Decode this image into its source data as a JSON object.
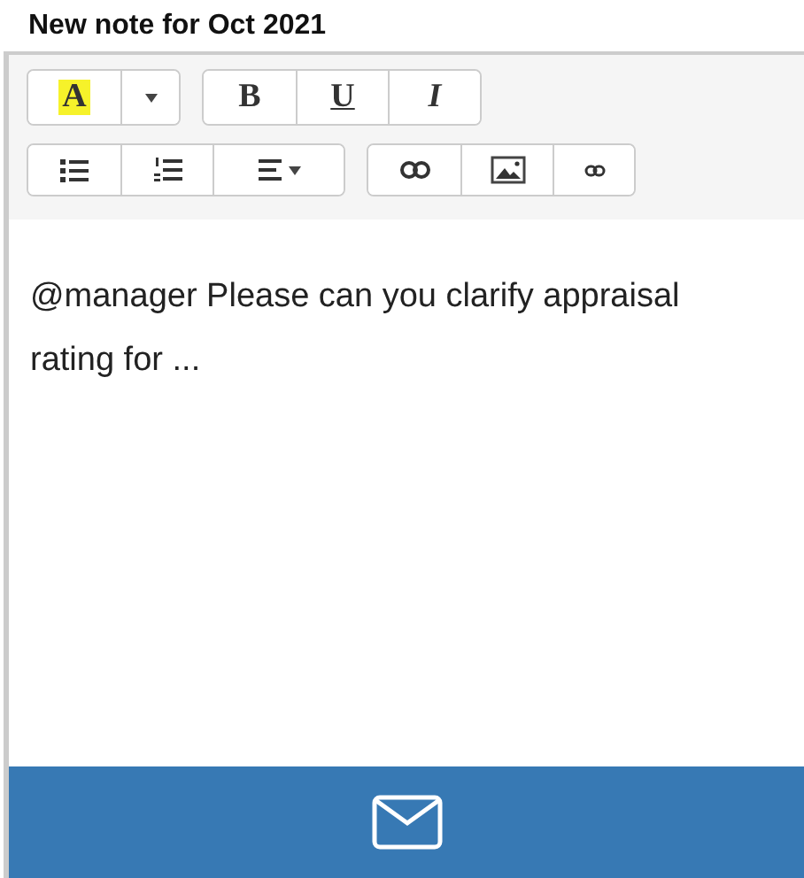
{
  "title": "New note for Oct 2021",
  "toolbar": {
    "rows": [
      [
        {
          "buttons": [
            {
              "kind": "highlight",
              "label": "A"
            },
            {
              "kind": "caret"
            }
          ]
        },
        {
          "buttons": [
            {
              "kind": "bold",
              "label": "B"
            },
            {
              "kind": "underline",
              "label": "U"
            },
            {
              "kind": "italic",
              "label": "I"
            }
          ]
        }
      ],
      [
        {
          "buttons": [
            {
              "kind": "bullets"
            },
            {
              "kind": "numbers"
            },
            {
              "kind": "align"
            }
          ]
        },
        {
          "buttons": [
            {
              "kind": "link"
            },
            {
              "kind": "image"
            },
            {
              "kind": "smalllink"
            }
          ]
        }
      ]
    ]
  },
  "body": "@manager Please can you clarify appraisal rating for ...",
  "send_button": {
    "kind": "mail"
  }
}
